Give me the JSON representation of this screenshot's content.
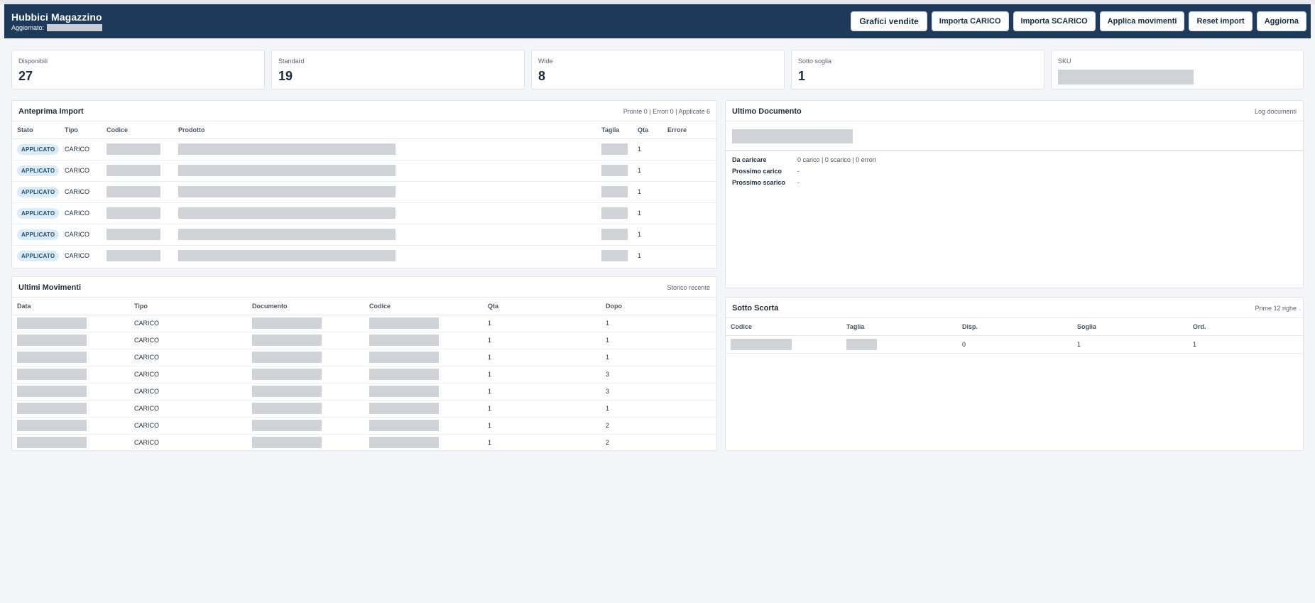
{
  "header": {
    "title": "Hubbici Magazzino",
    "updated_label": "Aggiornato:",
    "buttons": {
      "sales_charts": "Grafici vendite",
      "import_load": "Importa CARICO",
      "import_unload": "Importa SCARICO",
      "apply_moves": "Applica movimenti",
      "reset_import": "Reset import",
      "refresh": "Aggiorna"
    }
  },
  "kpis": {
    "available": {
      "label": "Disponibili",
      "value": "27"
    },
    "standard": {
      "label": "Standard",
      "value": "19"
    },
    "wide": {
      "label": "Wide",
      "value": "8"
    },
    "below_threshold": {
      "label": "Sotto soglia",
      "value": "1"
    },
    "sku": {
      "label": "SKU"
    }
  },
  "import_preview": {
    "title": "Anteprima Import",
    "meta": "Pronte 0 | Errori 0 | Applicate 6",
    "columns": {
      "status": "Stato",
      "type": "Tipo",
      "code": "Codice",
      "product": "Prodotto",
      "size": "Taglia",
      "qty": "Qta",
      "error": "Errore"
    },
    "rows": [
      {
        "status": "APPLICATO",
        "type": "CARICO",
        "qty": "1"
      },
      {
        "status": "APPLICATO",
        "type": "CARICO",
        "qty": "1"
      },
      {
        "status": "APPLICATO",
        "type": "CARICO",
        "qty": "1"
      },
      {
        "status": "APPLICATO",
        "type": "CARICO",
        "qty": "1"
      },
      {
        "status": "APPLICATO",
        "type": "CARICO",
        "qty": "1"
      },
      {
        "status": "APPLICATO",
        "type": "CARICO",
        "qty": "1"
      }
    ]
  },
  "last_document": {
    "title": "Ultimo Documento",
    "meta": "Log documenti",
    "fields": {
      "to_load": {
        "label": "Da caricare",
        "value": "0 carico | 0 scarico | 0 errori"
      },
      "next_load": {
        "label": "Prossimo carico",
        "value": "-"
      },
      "next_unload": {
        "label": "Prossimo scarico",
        "value": "-"
      }
    }
  },
  "recent_moves": {
    "title": "Ultimi Movimenti",
    "meta": "Storico recente",
    "columns": {
      "date": "Data",
      "type": "Tipo",
      "document": "Documento",
      "code": "Codice",
      "qty": "Qta",
      "after": "Dopo"
    },
    "rows": [
      {
        "type": "CARICO",
        "qty": "1",
        "after": "1"
      },
      {
        "type": "CARICO",
        "qty": "1",
        "after": "1"
      },
      {
        "type": "CARICO",
        "qty": "1",
        "after": "1"
      },
      {
        "type": "CARICO",
        "qty": "1",
        "after": "3"
      },
      {
        "type": "CARICO",
        "qty": "1",
        "after": "3"
      },
      {
        "type": "CARICO",
        "qty": "1",
        "after": "1"
      },
      {
        "type": "CARICO",
        "qty": "1",
        "after": "2"
      },
      {
        "type": "CARICO",
        "qty": "1",
        "after": "2"
      }
    ]
  },
  "low_stock": {
    "title": "Sotto Scorta",
    "meta": "Prime 12 righe",
    "columns": {
      "code": "Codice",
      "size": "Taglia",
      "available": "Disp.",
      "threshold": "Soglia",
      "ordered": "Ord."
    },
    "rows": [
      {
        "available": "0",
        "threshold": "1",
        "ordered": "1"
      }
    ]
  }
}
